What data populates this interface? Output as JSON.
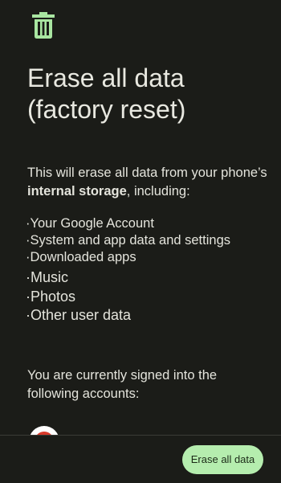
{
  "header": {
    "icon": "trash-icon",
    "icon_color": "#a9e6a1"
  },
  "title": {
    "line1": "Erase all data",
    "line2": "(factory reset)"
  },
  "intro": {
    "text_before": "This will erase all data from your phone’s ",
    "bold": "internal storage",
    "text_after": ", including:"
  },
  "items": [
    "·Your Google Account",
    "·System and app data and settings",
    "·Downloaded apps",
    "·Music",
    "·Photos",
    "·Other user data"
  ],
  "accounts": {
    "heading": "You are currently signed into the following accounts:",
    "avatar_icon": "account-avatar-icon"
  },
  "footer": {
    "erase_button_label": "Erase all data",
    "button_color": "#b5edae"
  }
}
